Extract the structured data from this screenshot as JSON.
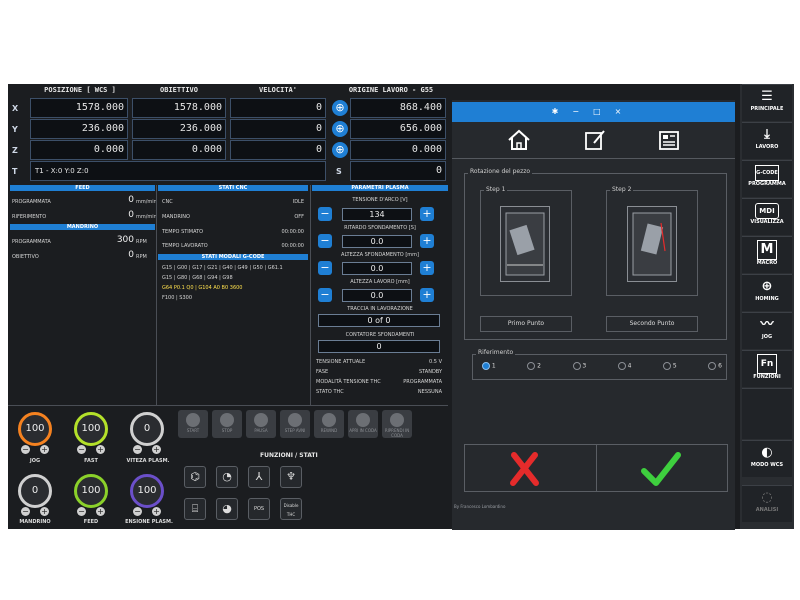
{
  "position_panel": {
    "headers": {
      "posizione": "POSIZIONE [ WCS ]",
      "obiettivo": "OBIETTIVO",
      "velocita": "VELOCITA'",
      "origine": "ORIGINE LAVORO - G55"
    },
    "axes": [
      {
        "label": "X",
        "pos": "1578.000",
        "target": "1578.000",
        "vel": "0",
        "origin": "868.400"
      },
      {
        "label": "Y",
        "pos": "236.000",
        "target": "236.000",
        "vel": "0",
        "origin": "656.000"
      },
      {
        "label": "Z",
        "pos": "0.000",
        "target": "0.000",
        "vel": "0",
        "origin": "0.000"
      }
    ],
    "tool_label": "T",
    "tool_value": "T1 - X:0 Y:0 Z:0",
    "s_label": "S",
    "s_value": "0"
  },
  "feed": {
    "title": "FEED",
    "rows": [
      {
        "label": "PROGRAMMATA",
        "value": "0",
        "unit": "mm/min"
      },
      {
        "label": "RIFERIMENTO",
        "value": "0",
        "unit": "mm/min"
      }
    ],
    "mandrino_title": "MANDRINO",
    "mandrino_rows": [
      {
        "label": "PROGRAMMATA",
        "value": "300",
        "unit": "RPM"
      },
      {
        "label": "OBIETTIVO",
        "value": "0",
        "unit": "RPM"
      }
    ]
  },
  "stati_cnc": {
    "title": "STATI CNC",
    "rows": [
      {
        "label": "CNC",
        "value": "IDLE"
      },
      {
        "label": "MANDRINO",
        "value": "OFF"
      },
      {
        "label": "TEMPO STIMATO",
        "value": "00:00:00"
      },
      {
        "label": "TEMPO LAVORATO",
        "value": "00:00:00"
      }
    ],
    "gcode_title": "STATI MODALI G-CODE",
    "gcode_lines": [
      "G15 | G00 | G17 | G21 | G40 | G49 | G50 | G61.1",
      "G15 | G80 | G68 | G94 | G98",
      "G64 P0.1 Q0 | G104 A0 B0 3600",
      "F100 | S300"
    ]
  },
  "plasma": {
    "title": "PARAMETRI PLASMA",
    "params": [
      {
        "label": "TENSIONE D'ARCO [V]",
        "value": "134"
      },
      {
        "label": "RITARDO SFONDAMENTO [S]",
        "value": "0.0"
      },
      {
        "label": "ALTEZZA SFONDAMENTO [mm]",
        "value": "0.0"
      },
      {
        "label": "ALTEZZA LAVORO [mm]",
        "value": "0.0"
      }
    ],
    "traccia_label": "TRACCIA IN LAVORAZIONE",
    "traccia_value": "0 of 0",
    "contatore_label": "CONTATORE SFONDAMENTI",
    "contatore_value": "0",
    "status_rows": [
      {
        "label": "TENSIONE ATTUALE",
        "value": "0.5 V"
      },
      {
        "label": "FASE",
        "value": "STANDBY"
      },
      {
        "label": "MODALITÀ TENSIONE THC",
        "value": "PROGRAMMATA"
      },
      {
        "label": "STATO THC",
        "value": "NESSUNA"
      }
    ]
  },
  "dials": [
    {
      "value": "100",
      "label": "JOG"
    },
    {
      "value": "100",
      "label": "FAST"
    },
    {
      "value": "0",
      "label": "VITEZA PLASM."
    },
    {
      "value": "0",
      "label": "MANDRINO"
    },
    {
      "value": "100",
      "label": "FEED"
    },
    {
      "value": "100",
      "label": "ENSIONE PLASM."
    }
  ],
  "controls": [
    "START",
    "STOP",
    "PAUSA",
    "STEP AVNI",
    "REWIND",
    "APRI IN CODA",
    "RIPRENDI IN CODA"
  ],
  "funzioni_title": "FUNZIONI / STATI",
  "func_icons": {
    "pos": "POS",
    "disable_thc": "Disable THC"
  },
  "dialog": {
    "icons": [
      "home-icon",
      "edit-icon",
      "list-icon"
    ],
    "group_title": "Rotazione del pezzo",
    "step1_label": "Step 1",
    "step2_label": "Step 2",
    "primo_punto": "Primo Punto",
    "secondo_punto": "Secondo Punto",
    "riferimento_title": "Riferimento",
    "radios": [
      "1",
      "2",
      "3",
      "4",
      "5",
      "6"
    ],
    "selected_radio": "1",
    "footer": "By Francesco Lombardino"
  },
  "sidebar": [
    {
      "label": "PRINCIPALE",
      "icon": "☰"
    },
    {
      "label": "LAVORO",
      "icon": "⤓"
    },
    {
      "label": "PROGRAMMA",
      "icon": "G-CODE"
    },
    {
      "label": "VISUALIZZA",
      "icon": "MDI"
    },
    {
      "label": "MACRO",
      "icon": "M"
    },
    {
      "label": "HOMING",
      "icon": "⊕"
    },
    {
      "label": "JOG",
      "icon": "〰"
    },
    {
      "label": "FUNZIONI",
      "icon": "Fn"
    },
    {
      "label": "",
      "icon": ""
    },
    {
      "label": "MODO WCS",
      "icon": "◐"
    },
    {
      "label": "ANALISI",
      "icon": "◌"
    }
  ],
  "colors": {
    "accent": "#1f7fd4",
    "confirm": "#3ecf3e",
    "cancel": "#e52b2b"
  }
}
